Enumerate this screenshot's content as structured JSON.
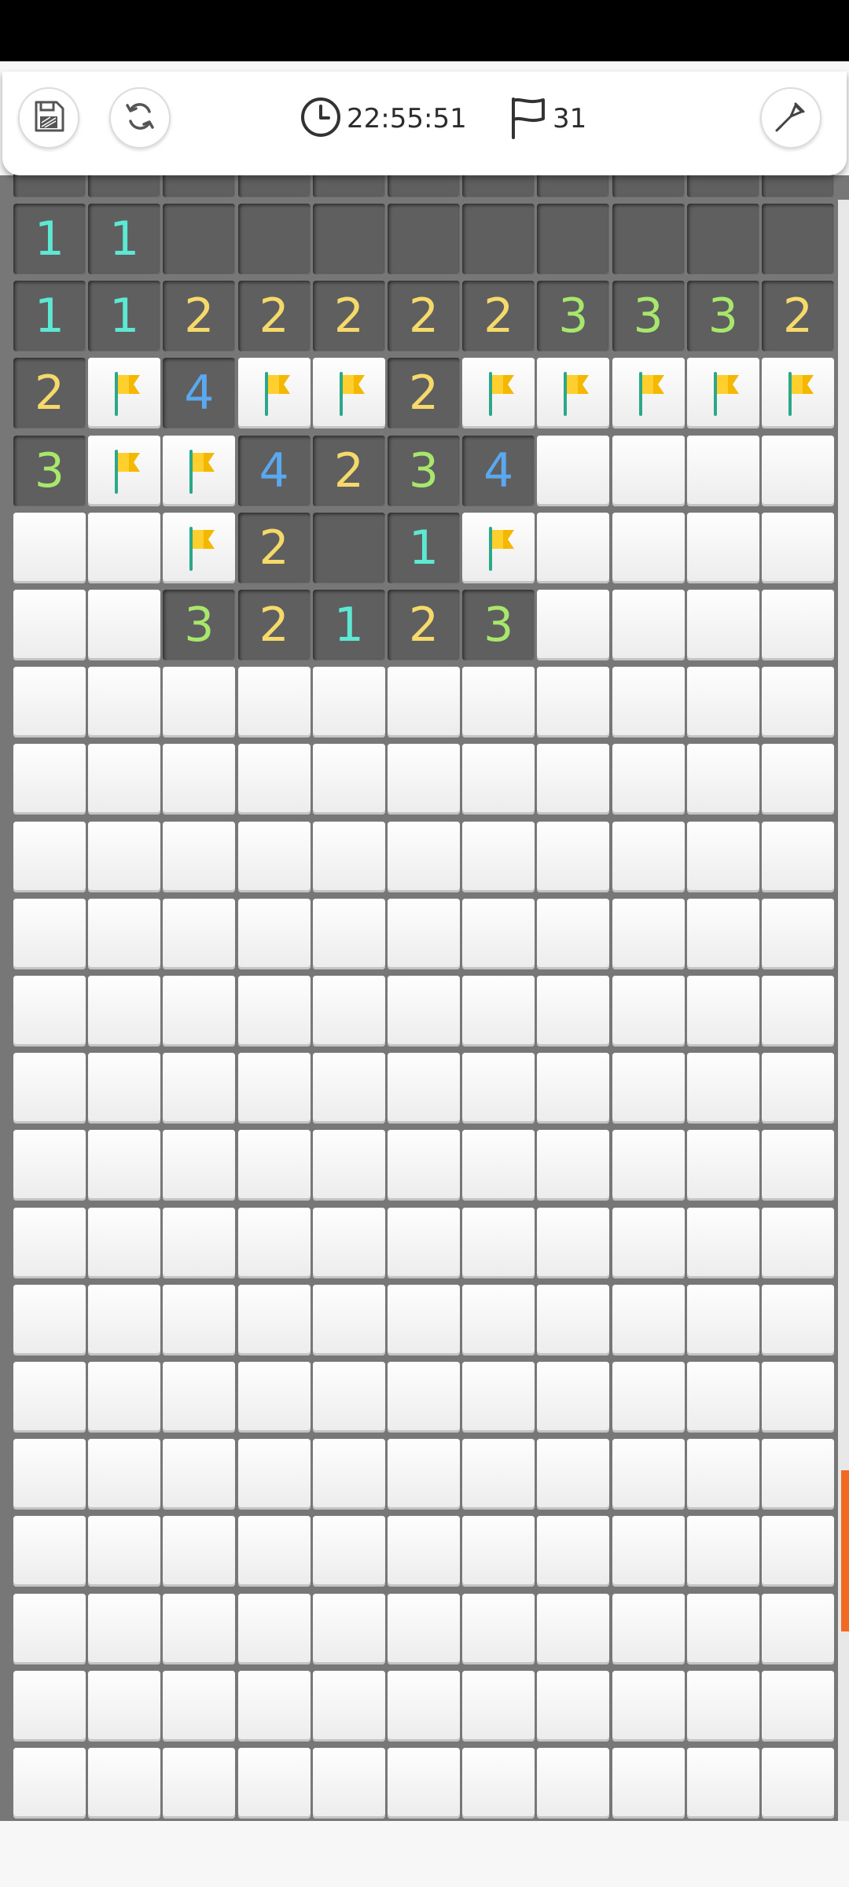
{
  "toolbar": {
    "timer": "22:55:51",
    "flags_remaining": "31",
    "icons": [
      "save-icon",
      "restart-icon",
      "clock-icon",
      "flag-icon",
      "shovel-icon"
    ]
  },
  "colors": {
    "n1": "#5ce8d2",
    "n2": "#f6d96b",
    "n3": "#a7e86c",
    "n4": "#5aa8f0",
    "flag": "#f5b800",
    "pole": "#2ba88a",
    "scroll_accent": "#f26a21"
  },
  "board": {
    "cols": 11,
    "legend": "C=covered, E=revealed empty, F=flag, 1-4 = revealed number",
    "rows": [
      "11EEEEEEEEE",
      "11222223332",
      "2F4FF2FFFFF",
      "3FF4234CCCC",
      "CCF2E1FCCCC",
      "CC32123CCCC",
      "CCCCCCCCCCC",
      "CCCCCCCCCCC",
      "CCCCCCCCCCC",
      "CCCCCCCCCCC",
      "CCCCCCCCCCC",
      "CCCCCCCCCCC",
      "CCCCCCCCCCC",
      "CCCCCCCCCCC",
      "CCCCCCCCCCC",
      "CCCCCCCCCCC",
      "CCCCCCCCCCC",
      "CCCCCCCCCCC",
      "CCCCCCCCCCC",
      "CCCCCCCCCCC",
      "CCCCCCCCCCC"
    ]
  }
}
